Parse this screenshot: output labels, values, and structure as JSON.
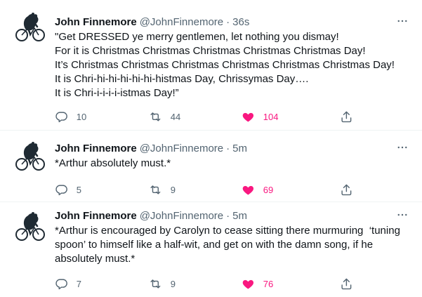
{
  "tweets": [
    {
      "name": "John Finnemore",
      "handle": "@JohnFinnemore",
      "separator": "·",
      "time": "36s",
      "text": "\"Get DRESSED ye merry gentlemen, let nothing you dismay!\nFor it is Christmas Christmas Christmas Christmas Christmas Day!\nIt’s Christmas Christmas Christmas Christmas Christmas Christmas Day!\nIt is Chri-hi-hi-hi-hi-hi-histmas Day, Chrissymas Day….\nIt is Chri-i-i-i-i-istmas Day!”",
      "replies": "10",
      "retweets": "44",
      "likes": "104"
    },
    {
      "name": "John Finnemore",
      "handle": "@JohnFinnemore",
      "separator": "·",
      "time": "5m",
      "text": "*Arthur absolutely must.*",
      "replies": "5",
      "retweets": "9",
      "likes": "69"
    },
    {
      "name": "John Finnemore",
      "handle": "@JohnFinnemore",
      "separator": "·",
      "time": "5m",
      "text": "*Arthur is encouraged by Carolyn to cease sitting there murmuring  ‘tuning spoon’ to himself like a half-wit, and get on with the damn song, if he absolutely must.*",
      "replies": "7",
      "retweets": "9",
      "likes": "76"
    }
  ],
  "colors": {
    "like": "#f91880",
    "secondary": "#536471",
    "text": "#0f1419",
    "divider": "#eff3f4"
  },
  "icons": {
    "avatar": "bear-on-bicycle-avatar",
    "more": "more-dots-icon",
    "reply": "reply-icon",
    "retweet": "retweet-icon",
    "like": "heart-icon",
    "share": "share-icon"
  }
}
